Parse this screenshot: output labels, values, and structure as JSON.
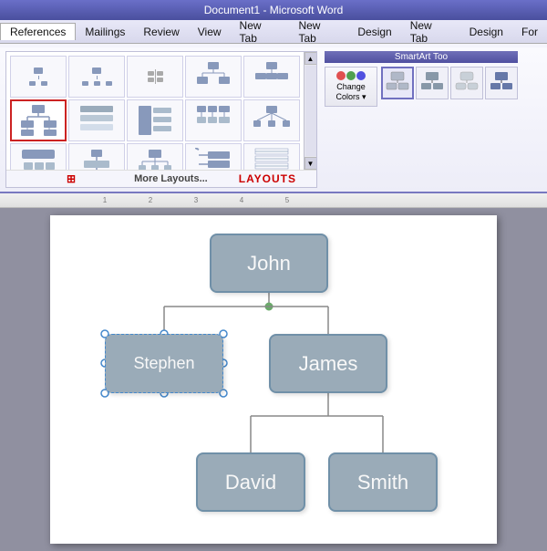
{
  "titlebar": {
    "text": "Document1 - Microsoft Word"
  },
  "menubar": {
    "items": [
      "References",
      "Mailings",
      "Review",
      "View",
      "New Tab",
      "New Tab",
      "Design",
      "New Tab",
      "Design",
      "For"
    ]
  },
  "ribbon": {
    "layouts_label": "LAYOUTS",
    "more_layouts_label": "More Layouts...",
    "smartart_label": "SmartArt Too",
    "change_colors_label": "Change\nColors ▾"
  },
  "org_chart": {
    "nodes": [
      {
        "id": "john",
        "label": "John"
      },
      {
        "id": "stephen",
        "label": "Stephen"
      },
      {
        "id": "james",
        "label": "James"
      },
      {
        "id": "david",
        "label": "David"
      },
      {
        "id": "smith",
        "label": "Smith"
      }
    ]
  },
  "ruler": {
    "marks": [
      "1",
      "2",
      "3",
      "4",
      "5"
    ]
  }
}
